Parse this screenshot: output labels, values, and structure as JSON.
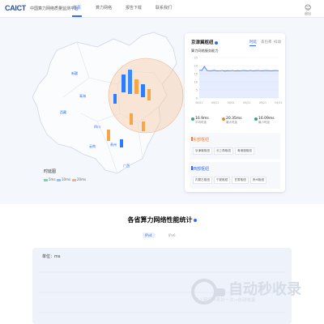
{
  "header": {
    "logo": "CAICT",
    "logo_sub": "中国算力网络质量监测平台",
    "nav": [
      "首页",
      "算力网络",
      "报告下载",
      "联系我们"
    ],
    "user_icon": "user-icon",
    "logout": "退出"
  },
  "map": {
    "provinces": [
      "新疆",
      "西藏",
      "青海",
      "四川",
      "云南",
      "贵州",
      "广西"
    ],
    "legend_title": "时延图",
    "legend": [
      {
        "label": "5ms",
        "color": "#7dd3a3"
      },
      {
        "label": "10ms",
        "color": "#8cc0ff"
      },
      {
        "label": "20ms",
        "color": "#f4b183"
      }
    ]
  },
  "panel": {
    "title": "京津冀枢纽",
    "tabs": [
      "时延",
      "丢包率",
      "抖动"
    ],
    "subtitle": "算力网络服务能力",
    "stats": [
      {
        "value": "16.9ms",
        "label": "平均时延",
        "color": "#3aa676"
      },
      {
        "value": "20.35ms",
        "label": "最大时延",
        "color": "#e38b3c"
      },
      {
        "value": "16.09ms",
        "label": "最小时延",
        "color": "#3aa676"
      }
    ],
    "regions": [
      {
        "title": "东部枢纽",
        "color": "#ff7a2f",
        "items": [
          "京津冀枢纽",
          "长三角枢纽",
          "粤港澳枢纽"
        ]
      },
      {
        "title": "西部枢纽",
        "color": "#2f6bff",
        "items": [
          "内蒙古枢纽",
          "宁夏枢纽",
          "甘肃枢纽",
          "贵州枢纽"
        ]
      }
    ]
  },
  "chart_data": {
    "type": "area",
    "title": "",
    "x": [
      "09/21",
      "09/21",
      "09/21",
      "09/21",
      "09/21",
      "09/21"
    ],
    "ylim": [
      0,
      25
    ],
    "y_ticks": [
      0,
      5,
      10,
      15,
      20,
      25
    ],
    "series": [
      {
        "values": [
          17.2,
          17.0,
          19.5,
          17.0,
          16.8,
          16.9,
          17.1,
          16.7,
          16.8,
          17.0,
          16.6,
          16.9,
          16.8,
          17.0,
          16.7,
          16.9,
          16.8,
          17.0,
          16.9,
          16.8,
          17.0,
          16.8,
          16.9,
          17.0,
          16.8,
          16.9,
          17.0,
          16.9,
          16.8,
          16.9,
          17.0,
          16.8
        ]
      }
    ]
  },
  "stats": {
    "title": "各省算力网络性能统计",
    "tabs": [
      "IPv4",
      "IPv6"
    ],
    "unit_label": "单位：",
    "unit": "ms"
  },
  "watermark": {
    "text": "自动秒收录",
    "sub": "做上链接→来访一次→自动收录"
  }
}
